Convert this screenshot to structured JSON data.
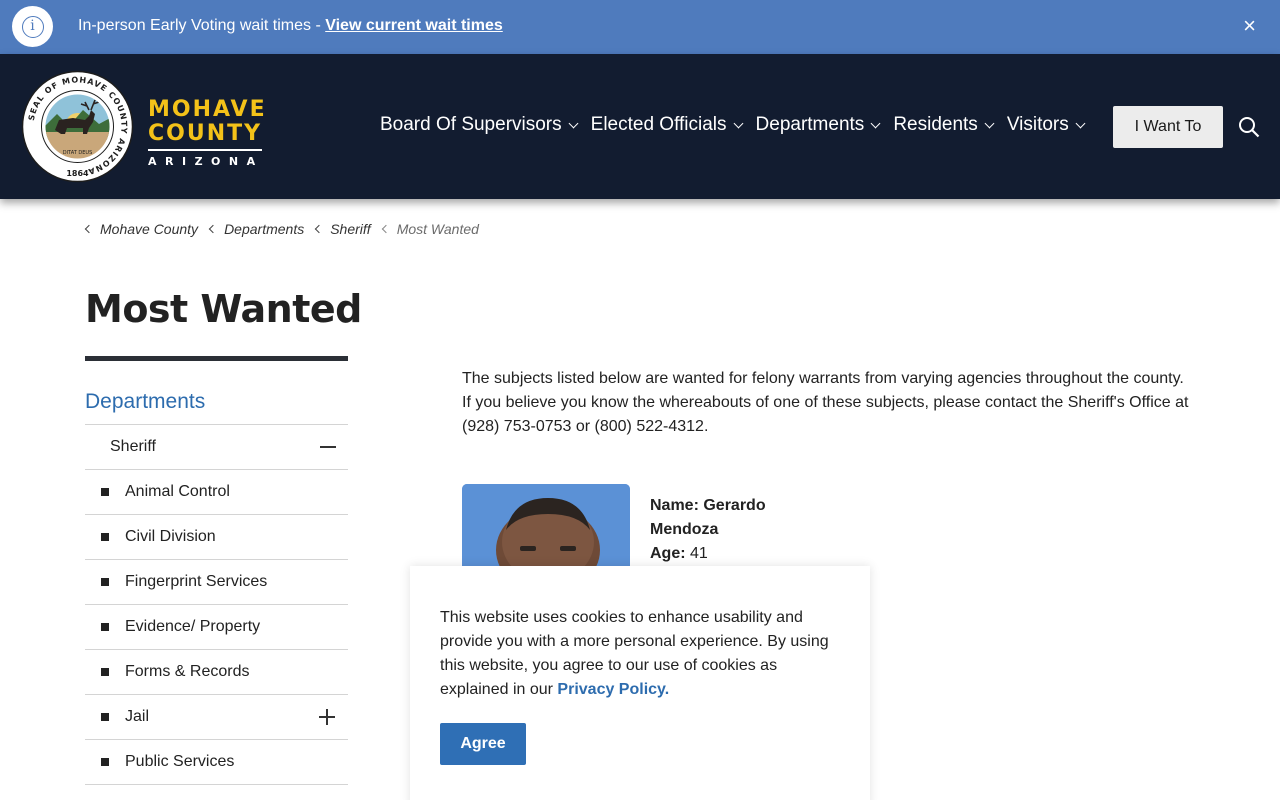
{
  "alert": {
    "message": "In-person Early Voting wait times - ",
    "link_text": "View current wait times",
    "close_glyph": "×",
    "icon": "info-icon"
  },
  "header": {
    "seal": {
      "ring_text": "SEAL OF MOHAVE COUNTY ARIZONA",
      "motto": "DITAT DEUS",
      "year": "1864"
    },
    "brand": {
      "line1": "MOHAVE",
      "line2": "COUNTY",
      "line3": "ARIZONA"
    },
    "nav": [
      {
        "label": "Board Of Supervisors"
      },
      {
        "label": "Elected Officials"
      },
      {
        "label": "Departments"
      },
      {
        "label": "Residents"
      },
      {
        "label": "Visitors"
      }
    ],
    "cta_label": "I Want To",
    "colors": {
      "background": "#121c30",
      "brand_yellow": "#f3c219"
    }
  },
  "breadcrumb": [
    {
      "label": "Mohave County"
    },
    {
      "label": "Departments"
    },
    {
      "label": "Sheriff"
    },
    {
      "label": "Most Wanted"
    }
  ],
  "page_title": "Most Wanted",
  "sidebar": {
    "heading": "Departments",
    "parent": "Sheriff",
    "items": [
      {
        "label": "Animal Control"
      },
      {
        "label": "Civil Division"
      },
      {
        "label": "Fingerprint Services"
      },
      {
        "label": "Evidence/ Property"
      },
      {
        "label": "Forms & Records"
      },
      {
        "label": "Jail"
      },
      {
        "label": "Public Services"
      }
    ]
  },
  "main": {
    "intro": "The subjects listed below are wanted for felony warrants from varying agencies throughout the county. If you believe you know the whereabouts of one of these subjects, please contact the Sheriff's Office at (928) 753-0753 or (800) 522-4312.",
    "subject": {
      "name_label": "Name:",
      "name_value": "Gerardo Mendoza",
      "age_label": "Age:",
      "age_value": "41"
    }
  },
  "cookie": {
    "text": "This website uses cookies to enhance usability and provide you with a more personal experience. By using this website, you agree to our use of cookies as explained in our ",
    "link": "Privacy Policy.",
    "button": "Agree"
  }
}
